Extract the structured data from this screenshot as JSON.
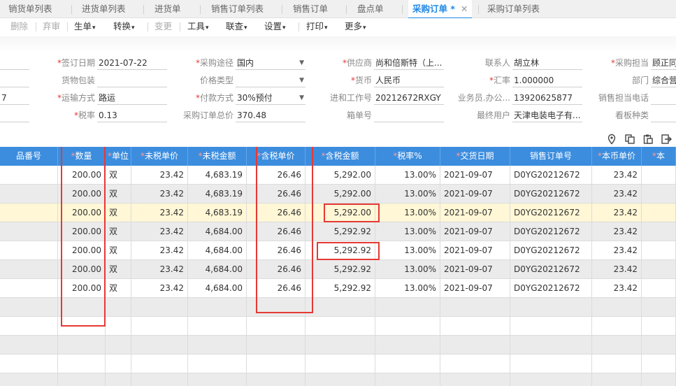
{
  "tabs": [
    {
      "label": "销货单列表"
    },
    {
      "label": "进货单列表"
    },
    {
      "label": "进货单"
    },
    {
      "label": "销售订单列表"
    },
    {
      "label": "销售订单"
    },
    {
      "label": "盘点单"
    },
    {
      "label": "采购订单 *",
      "active": true,
      "close": "✕"
    },
    {
      "label": "采购订单列表"
    }
  ],
  "toolbar": {
    "delete": "删除",
    "abandon": "弃审",
    "generate": "生单",
    "convert": "转换",
    "change": "变更",
    "tools": "工具",
    "link": "联查",
    "settings": "设置",
    "print": "打印",
    "more": "更多"
  },
  "form": {
    "sign_date": {
      "label": "签订日期",
      "value": "2021-07-22"
    },
    "purchase_channel": {
      "label": "采购途径",
      "value": "国内"
    },
    "supplier": {
      "label": "供应商",
      "value": "尚和倍斯特（上..."
    },
    "contact": {
      "label": "联系人",
      "value": "胡立林"
    },
    "purchase_owner": {
      "label": "采购担当",
      "value": "顾正同"
    },
    "packaging": {
      "label": "货物包装",
      "value": ""
    },
    "price_type": {
      "label": "价格类型",
      "value": ""
    },
    "currency": {
      "label": "货币",
      "value": "人民币"
    },
    "exchange_rate": {
      "label": "汇率",
      "value": "1.000000"
    },
    "department": {
      "label": "部门",
      "value": "综合营"
    },
    "left_partial_1": "7",
    "shipping": {
      "label": "运输方式",
      "value": "路运"
    },
    "payment": {
      "label": "付款方式",
      "value": "30%预付"
    },
    "work_no": {
      "label": "进和工作号",
      "value": "20212672RXGY"
    },
    "salesperson_phone": {
      "label": "业务员.办公...",
      "value": "13920625877"
    },
    "sales_phone": {
      "label": "销售担当电话",
      "value": ""
    },
    "tax_rate": {
      "label": "税率",
      "value": "0.13"
    },
    "order_total": {
      "label": "采购订单总价",
      "value": "370.48"
    },
    "box_no": {
      "label": "箱单号",
      "value": ""
    },
    "end_user": {
      "label": "最终用户",
      "value": "天津电装电子有..."
    },
    "board_type": {
      "label": "看板种类",
      "value": ""
    }
  },
  "icons": [
    "location-icon",
    "copy-icon",
    "paste-icon",
    "export-icon"
  ],
  "grid": {
    "headers": [
      {
        "key": "partno",
        "label": "品番号",
        "req": false
      },
      {
        "key": "qty",
        "label": "数量",
        "req": true
      },
      {
        "key": "unit",
        "label": "单位",
        "req": true
      },
      {
        "key": "price_ex",
        "label": "未税单价",
        "req": true
      },
      {
        "key": "amount_ex",
        "label": "未税金额",
        "req": true
      },
      {
        "key": "price_in",
        "label": "含税单价",
        "req": true
      },
      {
        "key": "amount_in",
        "label": "含税金额",
        "req": true
      },
      {
        "key": "taxrate",
        "label": "税率%",
        "req": true
      },
      {
        "key": "delivery",
        "label": "交货日期",
        "req": true
      },
      {
        "key": "sono",
        "label": "销售订单号",
        "req": false
      },
      {
        "key": "local_price",
        "label": "本币单价",
        "req": true
      },
      {
        "key": "extra",
        "label": "本",
        "req": true
      }
    ],
    "rows": [
      {
        "partno": "",
        "qty": "200.00",
        "unit": "双",
        "price_ex": "23.42",
        "amount_ex": "4,683.19",
        "price_in": "26.46",
        "amount_in": "5,292.00",
        "taxrate": "13.00%",
        "delivery": "2021-09-07",
        "sono": "D0YG20212672",
        "local_price": "23.42"
      },
      {
        "partno": "",
        "qty": "200.00",
        "unit": "双",
        "price_ex": "23.42",
        "amount_ex": "4,683.19",
        "price_in": "26.46",
        "amount_in": "5,292.00",
        "taxrate": "13.00%",
        "delivery": "2021-09-07",
        "sono": "D0YG20212672",
        "local_price": "23.42"
      },
      {
        "partno": "",
        "qty": "200.00",
        "unit": "双",
        "price_ex": "23.42",
        "amount_ex": "4,683.19",
        "price_in": "26.46",
        "amount_in": "5,292.00",
        "taxrate": "13.00%",
        "delivery": "2021-09-07",
        "sono": "D0YG20212672",
        "local_price": "23.42"
      },
      {
        "partno": "",
        "qty": "200.00",
        "unit": "双",
        "price_ex": "23.42",
        "amount_ex": "4,684.00",
        "price_in": "26.46",
        "amount_in": "5,292.92",
        "taxrate": "13.00%",
        "delivery": "2021-09-07",
        "sono": "D0YG20212672",
        "local_price": "23.42"
      },
      {
        "partno": "",
        "qty": "200.00",
        "unit": "双",
        "price_ex": "23.42",
        "amount_ex": "4,684.00",
        "price_in": "26.46",
        "amount_in": "5,292.92",
        "taxrate": "13.00%",
        "delivery": "2021-09-07",
        "sono": "D0YG20212672",
        "local_price": "23.42"
      },
      {
        "partno": "",
        "qty": "200.00",
        "unit": "双",
        "price_ex": "23.42",
        "amount_ex": "4,684.00",
        "price_in": "26.46",
        "amount_in": "5,292.92",
        "taxrate": "13.00%",
        "delivery": "2021-09-07",
        "sono": "D0YG20212672",
        "local_price": "23.42"
      },
      {
        "partno": "",
        "qty": "200.00",
        "unit": "双",
        "price_ex": "23.42",
        "amount_ex": "4,684.00",
        "price_in": "26.46",
        "amount_in": "5,292.92",
        "taxrate": "13.00%",
        "delivery": "2021-09-07",
        "sono": "D0YG20212672",
        "local_price": "23.42"
      }
    ],
    "empty_rows": 5,
    "selected_row_index": 2
  },
  "colors": {
    "accent": "#1e88e5",
    "header_bg": "#3c8dde",
    "highlight": "#e53935",
    "selected_row": "#fff7d6",
    "required": "#e53935"
  }
}
